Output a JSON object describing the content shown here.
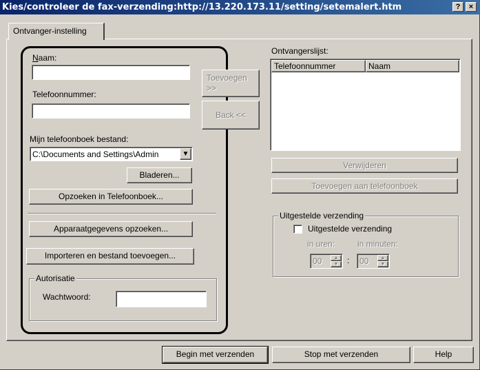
{
  "window": {
    "title": "Kies/controleer de fax-verzending:http://13.220.173.11/setting/setemalert.htm",
    "help_button": "?",
    "close_button": "×"
  },
  "tab": {
    "label": "Ontvanger-instelling"
  },
  "left": {
    "name_label": "Naam:",
    "name_value": "",
    "phone_label": "Telefoonnummer:",
    "phone_value": "",
    "phonebook_label": "Mijn telefoonboek bestand:",
    "phonebook_value": "C:\\Documents and Settings\\Admin",
    "browse_button": "Bladeren...",
    "lookup_phonebook_button": "Opzoeken in Telefoonboek...",
    "device_lookup_button": "Apparaatgegevens opzoeken...",
    "import_button": "Importeren en bestand toevoegen...",
    "auth_group": "Autorisatie",
    "password_label": "Wachtwoord:",
    "password_value": ""
  },
  "middle": {
    "add_button": "Toevoegen >>",
    "back_button": "Back <<"
  },
  "right": {
    "recipients_label": "Ontvangerslijst:",
    "columns": [
      "Telefoonnummer",
      "Naam"
    ],
    "rows": [],
    "delete_button": "Verwijderen",
    "add_to_phonebook_button": "Toevoegen aan telefoonboek",
    "delayed_group": "Uitgestelde verzending",
    "delayed_checkbox_label": "Uitgestelde verzending",
    "delayed_checked": false,
    "hours_label": "in uren:",
    "minutes_label": "in minuten:",
    "hours_value": "00",
    "minutes_value": "00",
    "time_separator": ":"
  },
  "footer": {
    "start_button": "Begin met verzenden",
    "stop_button": "Stop met verzenden",
    "help_button": "Help"
  }
}
